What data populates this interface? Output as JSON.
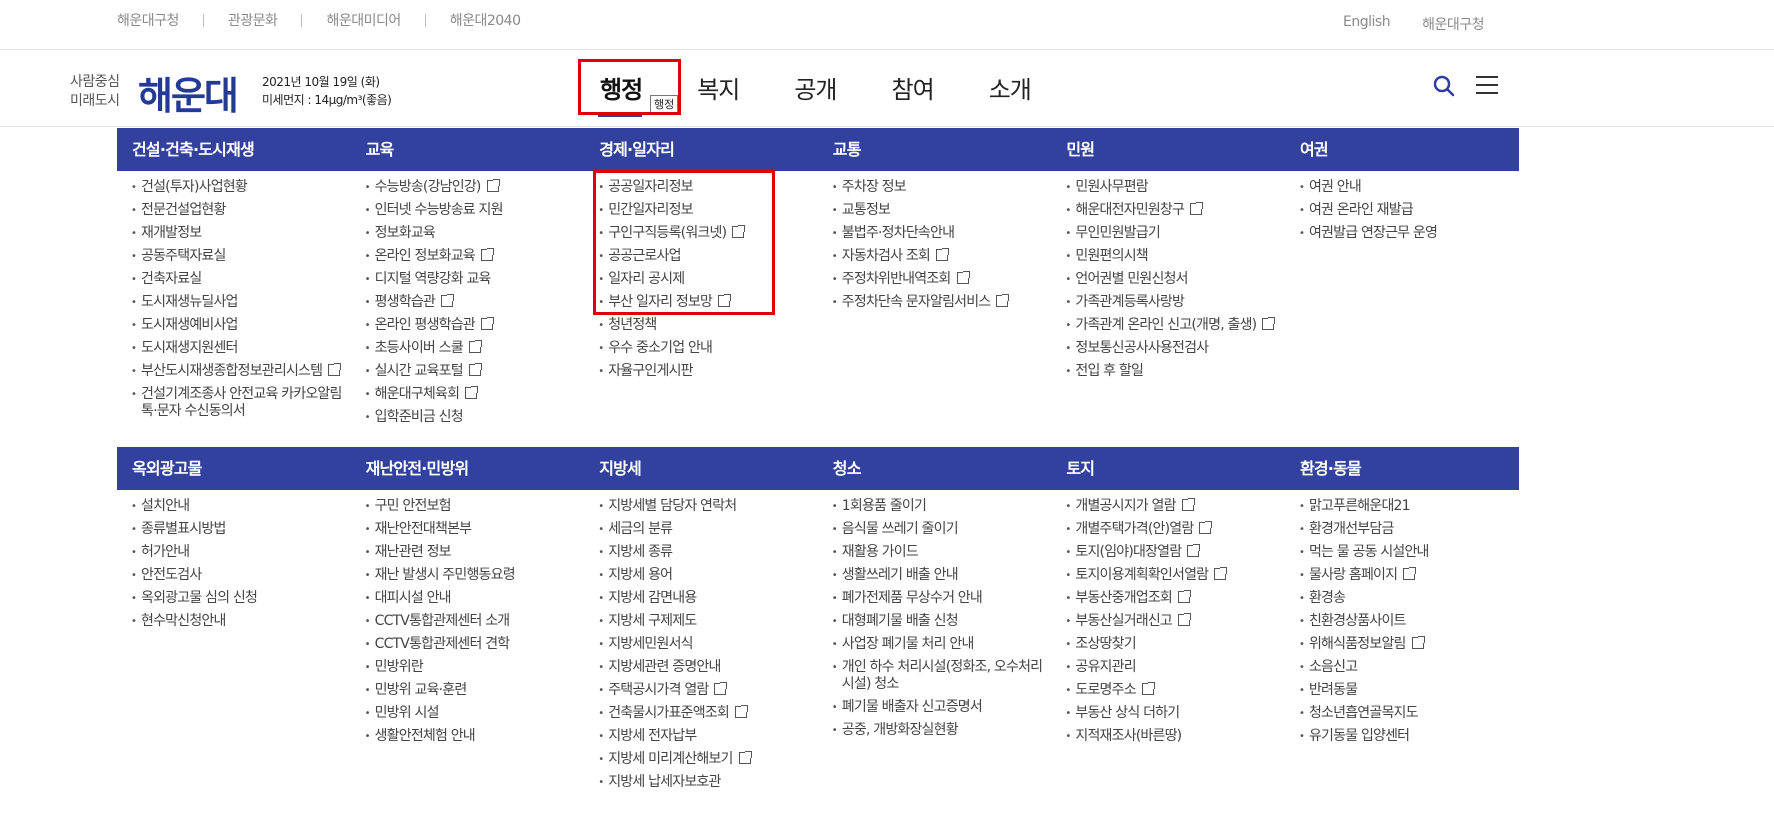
{
  "topbar": {
    "links": [
      "해운대구청",
      "관광문화",
      "해운대미디어",
      "해운대2040"
    ],
    "right": [
      "English",
      "해운대구청"
    ]
  },
  "header": {
    "slogan_line1": "사람중심",
    "slogan_line2": "미래도시",
    "logo_text": "해운대",
    "date": "2021년 10월 19일 (화)",
    "dust": "미세먼지 : 14μg/m³(좋음)",
    "gnb": [
      "행정",
      "복지",
      "공개",
      "참여",
      "소개"
    ],
    "tooltip": "행정"
  },
  "sections": [
    {
      "columns": [
        {
          "title": "건설·건축·도시재생",
          "items": [
            {
              "label": "건설(투자)사업현황",
              "ext": false
            },
            {
              "label": "전문건설업현황",
              "ext": false
            },
            {
              "label": "재개발정보",
              "ext": false
            },
            {
              "label": "공동주택자료실",
              "ext": false
            },
            {
              "label": "건축자료실",
              "ext": false
            },
            {
              "label": "도시재생뉴딜사업",
              "ext": false
            },
            {
              "label": "도시재생예비사업",
              "ext": false
            },
            {
              "label": "도시재생지원센터",
              "ext": false
            },
            {
              "label": "부산도시재생종합정보관리시스템",
              "ext": true
            },
            {
              "label": "건설기계조종사 안전교육 카카오알림톡·문자 수신동의서",
              "ext": false
            }
          ]
        },
        {
          "title": "교육",
          "items": [
            {
              "label": "수능방송(강남인강)",
              "ext": true
            },
            {
              "label": "인터넷 수능방송료 지원",
              "ext": false
            },
            {
              "label": "정보화교육",
              "ext": false
            },
            {
              "label": "온라인 정보화교육",
              "ext": true
            },
            {
              "label": "디지털 역량강화 교육",
              "ext": false
            },
            {
              "label": "평생학습관",
              "ext": true
            },
            {
              "label": "온라인 평생학습관",
              "ext": true
            },
            {
              "label": "초등사이버 스쿨",
              "ext": true
            },
            {
              "label": "실시간 교육포털",
              "ext": true
            },
            {
              "label": "해운대구체육회",
              "ext": true
            },
            {
              "label": "입학준비금 신청",
              "ext": false
            }
          ]
        },
        {
          "title": "경제·일자리",
          "items": [
            {
              "label": "공공일자리정보",
              "ext": false
            },
            {
              "label": "민간일자리정보",
              "ext": false
            },
            {
              "label": "구인구직등록(워크넷)",
              "ext": true
            },
            {
              "label": "공공근로사업",
              "ext": false
            },
            {
              "label": "일자리 공시제",
              "ext": false
            },
            {
              "label": "부산 일자리 정보망",
              "ext": true
            },
            {
              "label": "청년정책",
              "ext": false
            },
            {
              "label": "우수 중소기업 안내",
              "ext": false
            },
            {
              "label": "자율구인게시판",
              "ext": false
            }
          ]
        },
        {
          "title": "교통",
          "items": [
            {
              "label": "주차장 정보",
              "ext": false
            },
            {
              "label": "교통정보",
              "ext": false
            },
            {
              "label": "불법주·정차단속안내",
              "ext": false
            },
            {
              "label": "자동차검사 조회",
              "ext": true
            },
            {
              "label": "주정차위반내역조회",
              "ext": true
            },
            {
              "label": "주정차단속 문자알림서비스",
              "ext": true
            }
          ]
        },
        {
          "title": "민원",
          "items": [
            {
              "label": "민원사무편람",
              "ext": false
            },
            {
              "label": "해운대전자민원창구",
              "ext": true
            },
            {
              "label": "무인민원발급기",
              "ext": false
            },
            {
              "label": "민원편의시책",
              "ext": false
            },
            {
              "label": "언어권별 민원신청서",
              "ext": false
            },
            {
              "label": "가족관계등록사랑방",
              "ext": false
            },
            {
              "label": "가족관계 온라인 신고(개명, 출생)",
              "ext": true
            },
            {
              "label": "정보통신공사사용전검사",
              "ext": false
            },
            {
              "label": "전입 후 할일",
              "ext": false
            }
          ]
        },
        {
          "title": "여권",
          "items": [
            {
              "label": "여권 안내",
              "ext": false
            },
            {
              "label": "여권 온라인 재발급",
              "ext": false
            },
            {
              "label": "여권발급 연장근무 운영",
              "ext": false
            }
          ]
        }
      ]
    },
    {
      "columns": [
        {
          "title": "옥외광고물",
          "items": [
            {
              "label": "설치안내",
              "ext": false
            },
            {
              "label": "종류별표시방법",
              "ext": false
            },
            {
              "label": "허가안내",
              "ext": false
            },
            {
              "label": "안전도검사",
              "ext": false
            },
            {
              "label": "옥외광고물 심의 신청",
              "ext": false
            },
            {
              "label": "현수막신청안내",
              "ext": false
            }
          ]
        },
        {
          "title": "재난안전·민방위",
          "items": [
            {
              "label": "구민 안전보험",
              "ext": false
            },
            {
              "label": "재난안전대책본부",
              "ext": false
            },
            {
              "label": "재난관련 정보",
              "ext": false
            },
            {
              "label": "재난 발생시 주민행동요령",
              "ext": false
            },
            {
              "label": "대피시설 안내",
              "ext": false
            },
            {
              "label": "CCTV통합관제센터 소개",
              "ext": false
            },
            {
              "label": "CCTV통합관제센터 견학",
              "ext": false
            },
            {
              "label": "민방위란",
              "ext": false
            },
            {
              "label": "민방위 교육·훈련",
              "ext": false
            },
            {
              "label": "민방위 시설",
              "ext": false
            },
            {
              "label": "생활안전체험 안내",
              "ext": false
            }
          ]
        },
        {
          "title": "지방세",
          "items": [
            {
              "label": "지방세별 담당자 연락처",
              "ext": false
            },
            {
              "label": "세금의 분류",
              "ext": false
            },
            {
              "label": "지방세 종류",
              "ext": false
            },
            {
              "label": "지방세 용어",
              "ext": false
            },
            {
              "label": "지방세 감면내용",
              "ext": false
            },
            {
              "label": "지방세 구제제도",
              "ext": false
            },
            {
              "label": "지방세민원서식",
              "ext": false
            },
            {
              "label": "지방세관련 증명안내",
              "ext": false
            },
            {
              "label": "주택공시가격 열람",
              "ext": true
            },
            {
              "label": "건축물시가표준액조회",
              "ext": true
            },
            {
              "label": "지방세 전자납부",
              "ext": false
            },
            {
              "label": "지방세 미리계산해보기",
              "ext": true
            },
            {
              "label": "지방세 납세자보호관",
              "ext": false
            }
          ]
        },
        {
          "title": "청소",
          "items": [
            {
              "label": "1회용품 줄이기",
              "ext": false
            },
            {
              "label": "음식물 쓰레기 줄이기",
              "ext": false
            },
            {
              "label": "재활용 가이드",
              "ext": false
            },
            {
              "label": "생활쓰레기 배출 안내",
              "ext": false
            },
            {
              "label": "폐가전제품 무상수거 안내",
              "ext": false
            },
            {
              "label": "대형폐기물 배출 신청",
              "ext": false
            },
            {
              "label": "사업장 폐기물 처리 안내",
              "ext": false
            },
            {
              "label": "개인 하수 처리시설(정화조, 오수처리시설) 청소",
              "ext": false
            },
            {
              "label": "폐기물 배출자 신고증명서",
              "ext": false
            },
            {
              "label": "공중, 개방화장실현황",
              "ext": false
            }
          ]
        },
        {
          "title": "토지",
          "items": [
            {
              "label": "개별공시지가 열람",
              "ext": true
            },
            {
              "label": "개별주택가격(안)열람",
              "ext": true
            },
            {
              "label": "토지(임야)대장열람",
              "ext": true
            },
            {
              "label": "토지이용계획확인서열람",
              "ext": true
            },
            {
              "label": "부동산중개업조회",
              "ext": true
            },
            {
              "label": "부동산실거래신고",
              "ext": true
            },
            {
              "label": "조상땅찾기",
              "ext": false
            },
            {
              "label": "공유지관리",
              "ext": false
            },
            {
              "label": "도로명주소",
              "ext": true
            },
            {
              "label": "부동산 상식 더하기",
              "ext": false
            },
            {
              "label": "지적재조사(바른땅)",
              "ext": false
            }
          ]
        },
        {
          "title": "환경·동물",
          "items": [
            {
              "label": "맑고푸른해운대21",
              "ext": false
            },
            {
              "label": "환경개선부담금",
              "ext": false
            },
            {
              "label": "먹는 물 공동 시설안내",
              "ext": false
            },
            {
              "label": "물사랑 홈페이지",
              "ext": true
            },
            {
              "label": "환경송",
              "ext": false
            },
            {
              "label": "친환경상품사이트",
              "ext": false
            },
            {
              "label": "위해식품정보알림",
              "ext": true
            },
            {
              "label": "소음신고",
              "ext": false
            },
            {
              "label": "반려동물",
              "ext": false
            },
            {
              "label": "청소년흡연골목지도",
              "ext": false
            },
            {
              "label": "유기동물 입양센터",
              "ext": false
            }
          ]
        }
      ]
    }
  ]
}
